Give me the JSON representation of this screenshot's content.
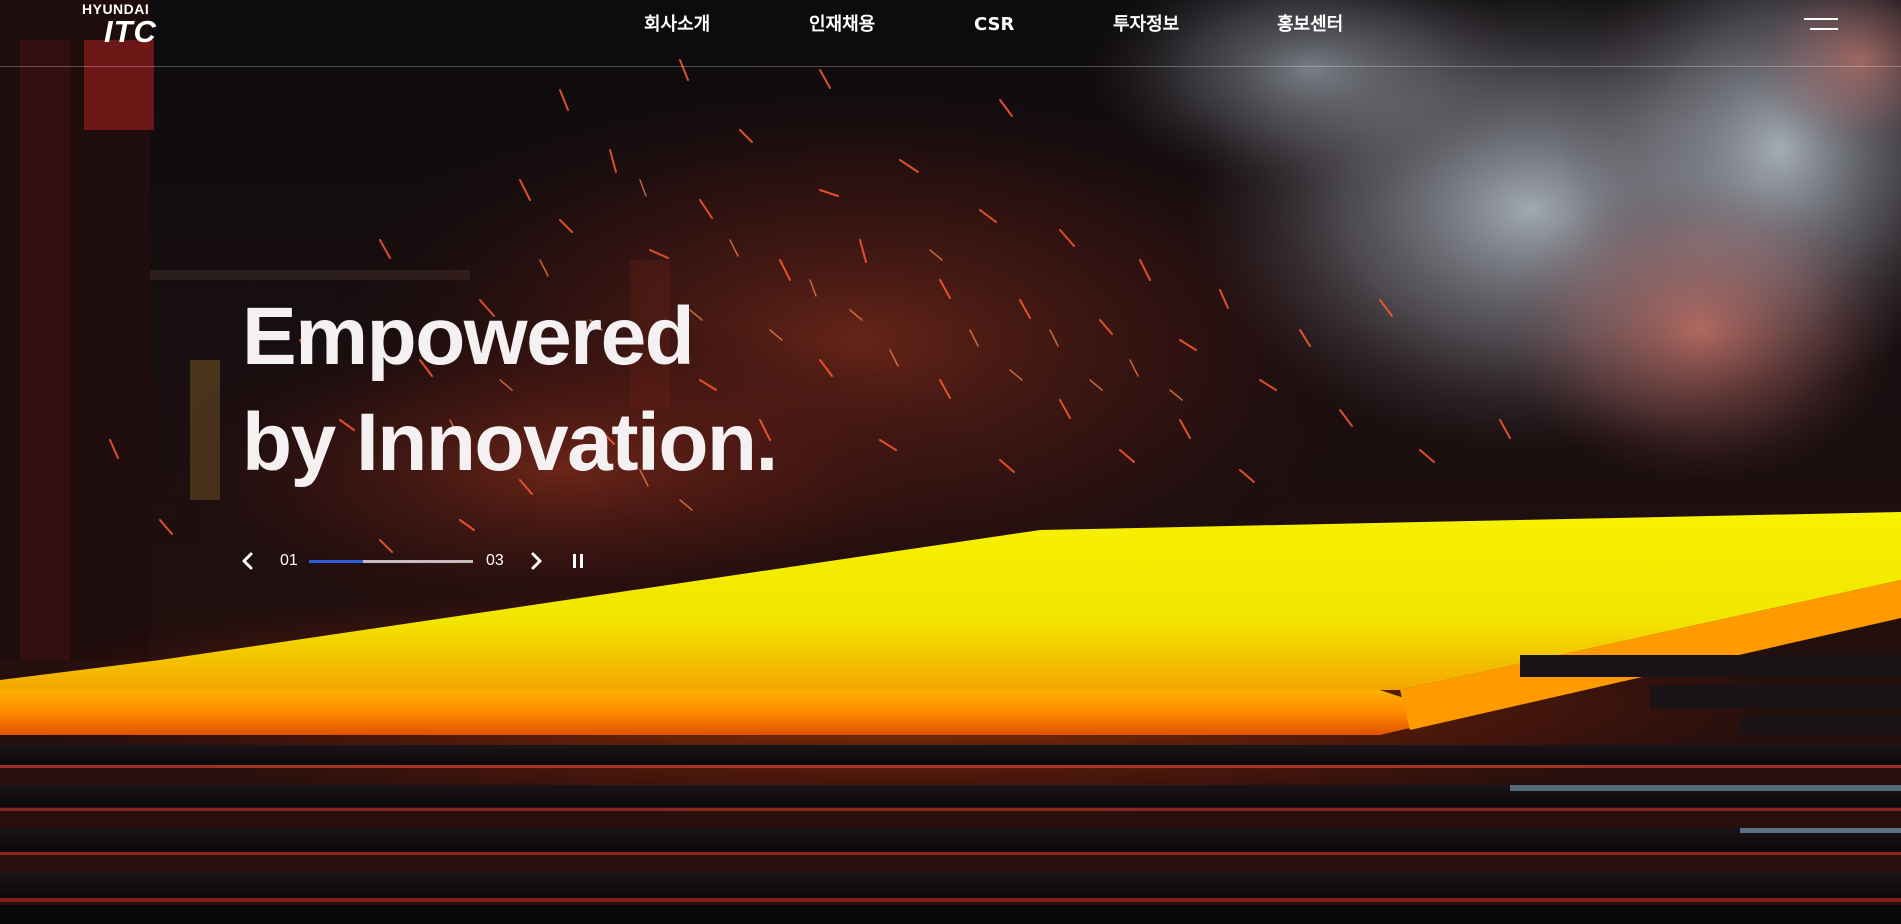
{
  "logo": {
    "top": "HYUNDAI",
    "bottom": "ITC"
  },
  "nav": {
    "items": [
      {
        "label": "회사소개"
      },
      {
        "label": "인재채용"
      },
      {
        "label": "CSR"
      },
      {
        "label": "투자정보"
      },
      {
        "label": "홍보센터"
      }
    ]
  },
  "menu_icon": "hamburger-menu-icon",
  "hero": {
    "headline_line1": "Empowered",
    "headline_line2": "by Innovation."
  },
  "slider": {
    "current": "01",
    "total": "03",
    "progress_fraction": 0.33,
    "prev_icon": "chevron-left-icon",
    "next_icon": "chevron-right-icon",
    "pause_icon": "pause-icon"
  },
  "colors": {
    "progress_fill": "#2f5dd8",
    "text": "#ffffff",
    "molten_steel": "#f2ec00"
  }
}
